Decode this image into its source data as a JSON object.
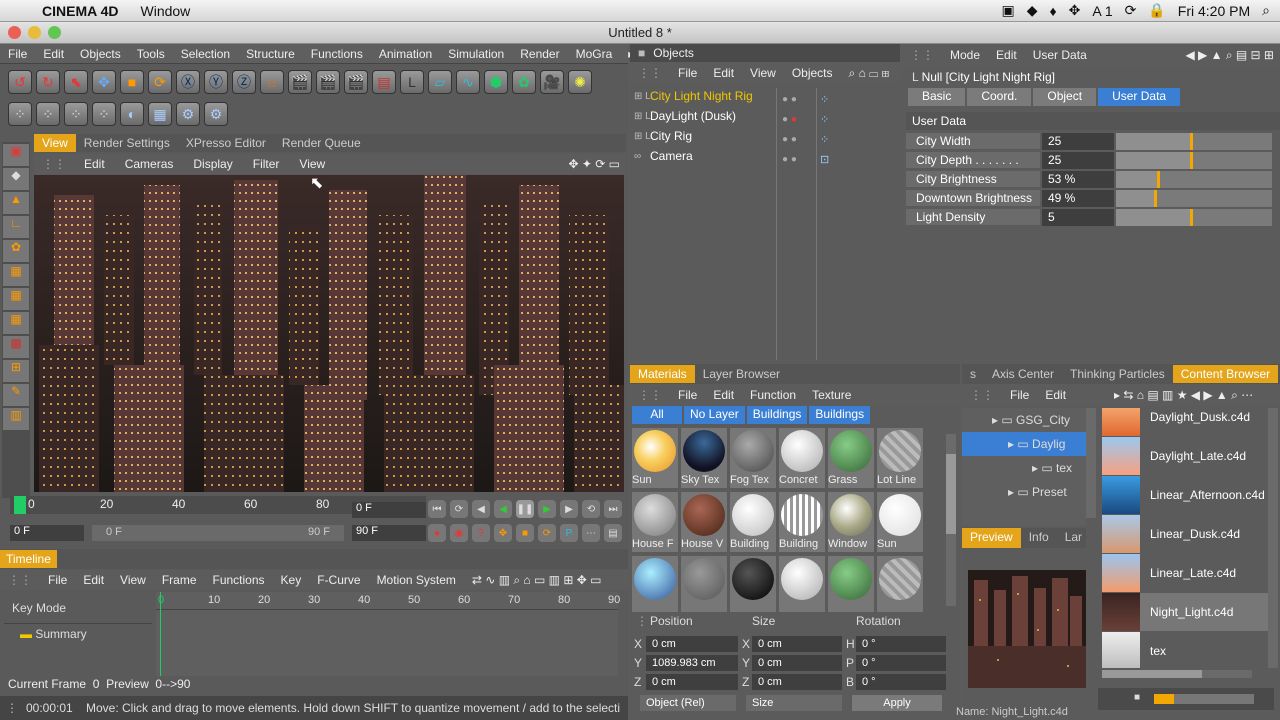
{
  "mac": {
    "app": "CINEMA 4D",
    "menu": "Window",
    "clock": "Fri 4:20 PM",
    "status": "A 1"
  },
  "window": {
    "title": "Untitled 8 *"
  },
  "main_menu": [
    "File",
    "Edit",
    "Objects",
    "Tools",
    "Selection",
    "Structure",
    "Functions",
    "Animation",
    "Simulation",
    "Render",
    "MoGra"
  ],
  "view_tabs": [
    "View",
    "Render Settings",
    "XPresso Editor",
    "Render Queue"
  ],
  "viewport_menu": [
    "Edit",
    "Cameras",
    "Display",
    "Filter",
    "View"
  ],
  "ruler": {
    "ticks": [
      "0",
      "20",
      "40",
      "60",
      "80"
    ]
  },
  "frames": {
    "current": "0 F",
    "start": "0 F",
    "slider_start": "0 F",
    "slider_end": "90 F",
    "end": "90 F"
  },
  "timeline": {
    "title": "Timeline",
    "menu": [
      "File",
      "Edit",
      "View",
      "Frame",
      "Functions",
      "Key",
      "F-Curve",
      "Motion System"
    ],
    "key_mode": "Key Mode",
    "summary": "Summary",
    "ticks": [
      "0",
      "10",
      "20",
      "30",
      "40",
      "50",
      "60",
      "70",
      "80",
      "90"
    ],
    "current_frame_label": "Current Frame",
    "current_frame": "0",
    "preview_label": "Preview",
    "preview": "0-->90"
  },
  "status": {
    "time": "00:00:01",
    "message": "Move: Click and drag to move elements. Hold down SHIFT to quantize movement / add to the selecti"
  },
  "objects": {
    "title": "Objects",
    "menu": [
      "File",
      "Edit",
      "View",
      "Objects"
    ],
    "items": [
      {
        "label": "City Light Night Rig",
        "color": "#f0c800"
      },
      {
        "label": "DayLight (Dusk)",
        "color": "#ffffff"
      },
      {
        "label": "City Rig",
        "color": "#ffffff"
      },
      {
        "label": "Camera",
        "color": "#ffffff"
      }
    ]
  },
  "attributes": {
    "menu": [
      "Mode",
      "Edit",
      "User Data"
    ],
    "object_title": "Null [City Light Night Rig]",
    "tabs": [
      "Basic",
      "Coord.",
      "Object",
      "User Data"
    ],
    "section": "User Data",
    "fields": [
      {
        "label": "City Width",
        "value": "25",
        "level": 0.95
      },
      {
        "label": "City Depth . . . . . . .",
        "value": "25",
        "level": 0.95
      },
      {
        "label": "City Brightness",
        "value": "53 %",
        "level": 0.53
      },
      {
        "label": "Downtown Brightness",
        "value": "49 %",
        "level": 0.49
      },
      {
        "label": "Light Density",
        "value": "5",
        "level": 0.95
      }
    ]
  },
  "materials": {
    "tabs": [
      "Materials",
      "Layer Browser"
    ],
    "menu": [
      "File",
      "Edit",
      "Function",
      "Texture"
    ],
    "filters": [
      "All",
      "No Layer",
      "Buildings",
      "Buildings"
    ],
    "items": [
      {
        "label": "Sun"
      },
      {
        "label": "Sky Tex"
      },
      {
        "label": "Fog Tex"
      },
      {
        "label": "Concret"
      },
      {
        "label": "Grass"
      },
      {
        "label": "Lot Line"
      },
      {
        "label": "House F"
      },
      {
        "label": "House V"
      },
      {
        "label": "Building"
      },
      {
        "label": "Building"
      },
      {
        "label": "Window"
      },
      {
        "label": "Sun"
      },
      {
        "label": ""
      },
      {
        "label": ""
      },
      {
        "label": ""
      },
      {
        "label": ""
      },
      {
        "label": ""
      },
      {
        "label": ""
      }
    ]
  },
  "coords": {
    "headers": [
      "Position",
      "Size",
      "Rotation"
    ],
    "rows": [
      {
        "axis": "X",
        "pos": "0 cm",
        "saxis": "X",
        "size": "0 cm",
        "raxis": "H",
        "rot": "0 °"
      },
      {
        "axis": "Y",
        "pos": "1089.983 cm",
        "saxis": "Y",
        "size": "0 cm",
        "raxis": "P",
        "rot": "0 °"
      },
      {
        "axis": "Z",
        "pos": "0 cm",
        "saxis": "Z",
        "size": "0 cm",
        "raxis": "B",
        "rot": "0 °"
      }
    ],
    "mode": "Object (Rel)",
    "size_mode": "Size",
    "apply": "Apply"
  },
  "browser": {
    "tabs": [
      "s",
      "Axis Center",
      "Thinking Particles",
      "Content Browser"
    ],
    "menu": [
      "File",
      "Edit"
    ],
    "tree": [
      "GSG_City",
      "Daylig",
      "tex",
      "Preset"
    ],
    "preview_tabs": [
      "Preview",
      "Info",
      "Lar"
    ],
    "footer": "Name: Night_Light.c4d",
    "files": [
      "Daylight_Dusk.c4d",
      "Daylight_Late.c4d",
      "Linear_Afternoon.c4d",
      "Linear_Dusk.c4d",
      "Linear_Late.c4d",
      "Night_Light.c4d",
      "tex"
    ]
  }
}
